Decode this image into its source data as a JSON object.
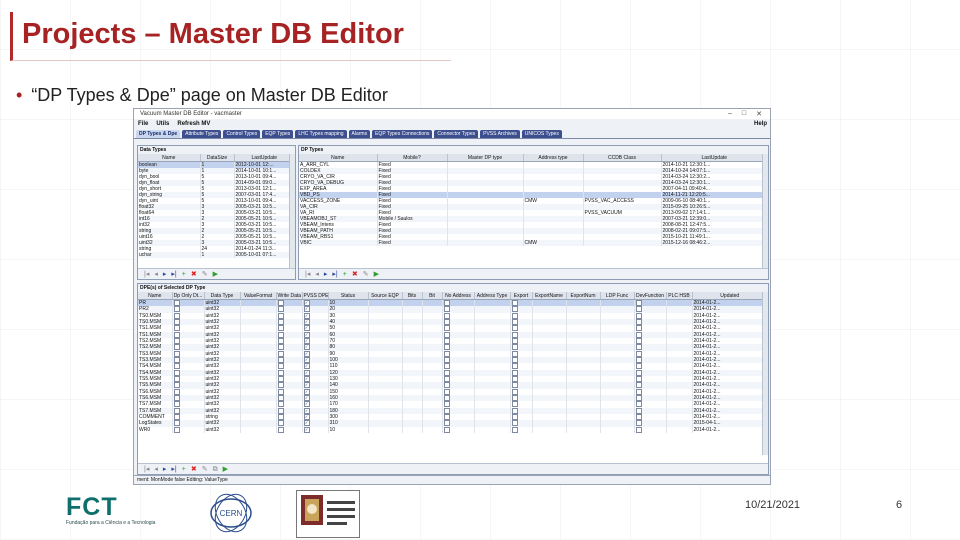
{
  "slide": {
    "title": "Projects – Master DB Editor",
    "bullet": "“DP Types & Dpe” page on Master DB Editor",
    "date": "10/21/2021",
    "page_number": "6"
  },
  "app": {
    "window_title": "Vacuum Master DB Editor - vacmaster",
    "menu": [
      "File",
      "Utils",
      "Refresh MV"
    ],
    "menu_right": "Help",
    "tabs": [
      "DP Types & Dpe",
      "Attribute Types",
      "Control Types",
      "EQP Types",
      "LHC Types mapping",
      "Alarms",
      "EQP Types Connections",
      "Connector Types",
      "PVSS Archives",
      "UNICOS Types"
    ],
    "active_tab_index": 0
  },
  "data_types": {
    "title": "Data Types",
    "columns": [
      "Name",
      "DataSize",
      "LastUpdate"
    ],
    "rows": [
      [
        "boolean",
        "1",
        "2012-10-01 12:..."
      ],
      [
        "byte",
        "1",
        "2014-10-01 10:1..."
      ],
      [
        "dyn_bool",
        "5",
        "2013-10-01 09:4..."
      ],
      [
        "dyn_float",
        "5",
        "2014-09-01 09:0..."
      ],
      [
        "dyn_short",
        "5",
        "2013-03-01 12:1..."
      ],
      [
        "dyn_string",
        "5",
        "2007-03-01 17:4..."
      ],
      [
        "dyn_uint",
        "5",
        "2013-10-01 09:4..."
      ],
      [
        "float32",
        "3",
        "2005-03-21 10:5..."
      ],
      [
        "float64",
        "3",
        "2005-03-21 10:5..."
      ],
      [
        "int16",
        "2",
        "2005-05-21 10:5..."
      ],
      [
        "int32",
        "3",
        "2005-03-21 10:5..."
      ],
      [
        "string",
        "2",
        "2005-05-21 10:5..."
      ],
      [
        "uint16",
        "2",
        "2005-05-21 10:5..."
      ],
      [
        "uint32",
        "3",
        "2005-03-21 10:5..."
      ],
      [
        "string",
        "24",
        "2014-01-24 11:3..."
      ],
      [
        "uchar",
        "1",
        "2005-10-01 07:1..."
      ]
    ]
  },
  "dp_types": {
    "title": "DP Types",
    "columns": [
      "Name",
      "Mobile?",
      "Master DP type",
      "Address type",
      "CCDB Class",
      "LastUpdate"
    ],
    "rows": [
      [
        "A_ARR_CYL",
        "Fixed",
        "",
        "",
        "",
        "2014-10-21 12:30:1..."
      ],
      [
        "COLDEX",
        "Fixed",
        "",
        "",
        "",
        "2014-10-24 14:07:1..."
      ],
      [
        "CRYO_VA_CIR",
        "Fixed",
        "",
        "",
        "",
        "2014-03-24 12:30:2..."
      ],
      [
        "CRYO_VA_DEBUG",
        "Fixed",
        "",
        "",
        "",
        "2014-03-24 12:30:1..."
      ],
      [
        "EXP_AREA",
        "Fixed",
        "",
        "",
        "",
        "2007-04-11 09:40:4..."
      ],
      [
        "VBD_PS",
        "Fixed",
        "",
        "",
        "",
        "2014-11-21 12:20:5..."
      ],
      [
        "VACCESS_ZONE",
        "Fixed",
        "",
        "CMW",
        "PVSS_VAC_ACCESS",
        "2009-06-10 08:40:1..."
      ],
      [
        "VA_CIR",
        "Fixed",
        "",
        "",
        "",
        "2015-09-25 10:26:5..."
      ],
      [
        "VA_RI",
        "Fixed",
        "",
        "",
        "PVSS_VACUUM",
        "2013-09-02 17:14:1..."
      ],
      [
        "VBEAMOBJ_ST",
        "Mobile / Saulos",
        "",
        "",
        "",
        "2007-03-21 12:39:0..."
      ],
      [
        "VBEAM_Intens",
        "Fixed",
        "",
        "",
        "",
        "2008-08-21 12:47:5..."
      ],
      [
        "VBEAM_PATH",
        "Fixed",
        "",
        "",
        "",
        "2008-02-21 09:07:5..."
      ],
      [
        "VBEAM_RBS1",
        "Fixed",
        "",
        "",
        "",
        "2015-10-21 11:49:1..."
      ],
      [
        "VBIC",
        "Fixed",
        "",
        "CMW",
        "",
        "2015-12-16 08:46:2..."
      ]
    ]
  },
  "dpe_table": {
    "title": "DPE(s) of Selected DP Type",
    "columns": [
      "Name",
      "Dp Only Dt...",
      "Data Type",
      "ValueFormat",
      "Write Data",
      "PVSS DPE",
      "Status",
      "Source EQP",
      "Bits",
      "Bit",
      "No Address",
      "Address Type",
      "Export",
      "ExportName",
      "ExportNum",
      "LDP Func",
      "DevFunction",
      "PLC HSB",
      "Updated"
    ],
    "rows": [
      [
        "PR",
        "uint32",
        "10",
        "2014-01-2..."
      ],
      [
        "PR2",
        "uint32",
        "20",
        "2014-01-2..."
      ],
      [
        "TS0.MSM",
        "uint32",
        "30",
        "2014-01-2..."
      ],
      [
        "TS0.MSM",
        "uint32",
        "40",
        "2014-01-2..."
      ],
      [
        "TS1.MSM",
        "uint32",
        "50",
        "2014-01-2..."
      ],
      [
        "TS1.MSM",
        "uint32",
        "60",
        "2014-01-2..."
      ],
      [
        "TS2.MSM",
        "uint32",
        "70",
        "2014-01-2..."
      ],
      [
        "TS2.MSM",
        "uint32",
        "80",
        "2014-01-2..."
      ],
      [
        "TS3.MSM",
        "uint32",
        "90",
        "2014-01-2..."
      ],
      [
        "TS3.MSM",
        "uint32",
        "100",
        "2014-01-2..."
      ],
      [
        "TS4.MSM",
        "uint32",
        "110",
        "2014-01-2..."
      ],
      [
        "TS4.MSM",
        "uint32",
        "120",
        "2014-01-2..."
      ],
      [
        "TS5.MSM",
        "uint32",
        "130",
        "2014-01-2..."
      ],
      [
        "TS5.MSM",
        "uint32",
        "140",
        "2014-01-2..."
      ],
      [
        "TS6.MSM",
        "uint32",
        "150",
        "2014-01-2..."
      ],
      [
        "TS6.MSM",
        "uint32",
        "160",
        "2014-01-2..."
      ],
      [
        "TS7.MSM",
        "uint32",
        "170",
        "2014-01-2..."
      ],
      [
        "TS7.MSM",
        "uint32",
        "180",
        "2014-01-2..."
      ],
      [
        "COMMENT",
        "string",
        "300",
        "2014-01-2..."
      ],
      [
        "LogStates",
        "uint32",
        "310",
        "2015-04-1..."
      ],
      [
        "WR0",
        "uint32",
        "10",
        "2014-01-2..."
      ]
    ],
    "status_text": "ment: MonMode false Editing: ValueType"
  },
  "logos": {
    "fct_name": "FCT",
    "fct_caption": "Fundação para a Ciência e a Tecnologia",
    "cern_name": "CERN"
  },
  "colors": {
    "title_red": "#a62223",
    "tab_blue": "#3e4f8f",
    "fct_green": "#0f6f6c"
  }
}
